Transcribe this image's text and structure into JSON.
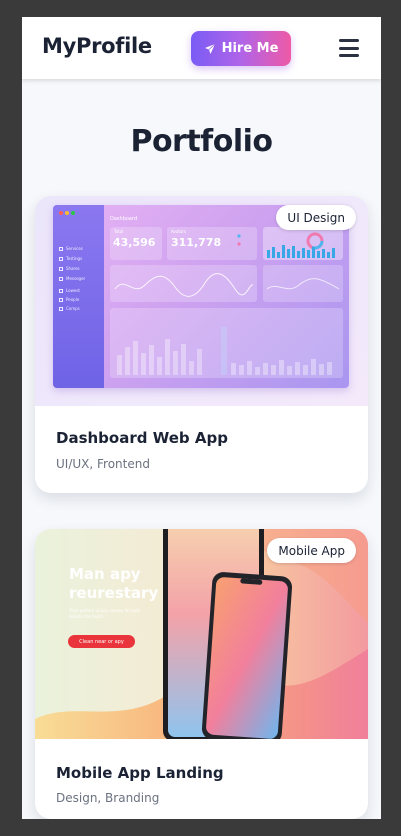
{
  "header": {
    "brand": "MyProfile",
    "hire_label": "Hire Me",
    "hire_icon": "paper-plane-icon",
    "menu_icon": "hamburger-menu-icon"
  },
  "main": {
    "section_title": "Portfolio",
    "projects": [
      {
        "title": "Dashboard Web App",
        "subtitle": "UI/UX, Frontend",
        "tag": "UI Design",
        "thumbnail": {
          "header": "Dashboard",
          "stat1_label": "Total",
          "stat1": "43,596",
          "stat2_label": "Avatars",
          "stat2": "311,778",
          "side_items": [
            "Services",
            "Testings",
            "Shares",
            "Messeger",
            "Lowest",
            "People",
            "Comps"
          ]
        }
      },
      {
        "title": "Mobile App Landing",
        "subtitle": "Design, Branding",
        "tag": "Mobile App",
        "thumbnail": {
          "headline_1": "Man apy",
          "headline_2": "reurestary",
          "body": "Tiras perlorn ui ipsy suntey far kuto doanto the faciiti",
          "cta": "Clean near or apy"
        }
      }
    ]
  },
  "colors": {
    "accent_start": "#7a5cf5",
    "accent_end": "#ee5aa6",
    "text_dark": "#1a2234",
    "text_muted": "#6b7280",
    "page_bg": "#f6f8fb"
  }
}
